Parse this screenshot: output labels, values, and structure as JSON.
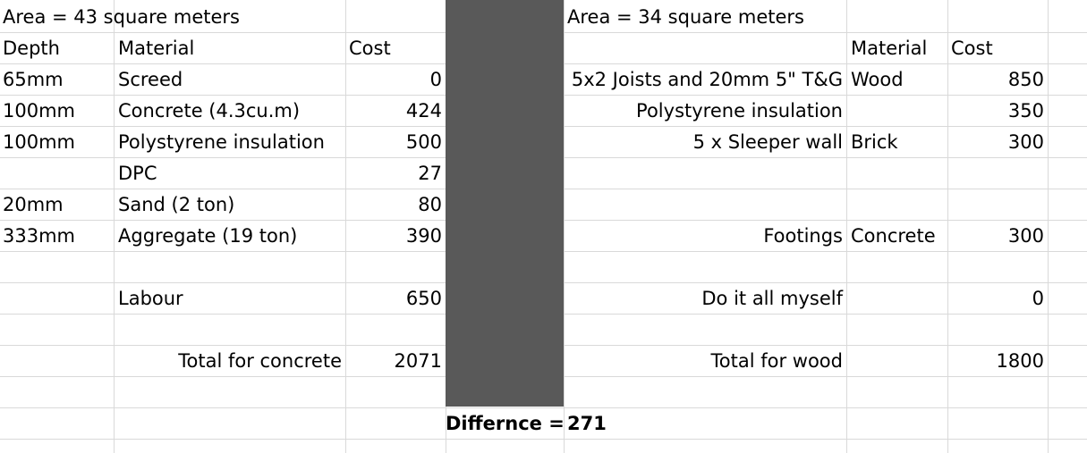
{
  "left_table": {
    "area": "Area = 43 square meters",
    "headers": {
      "depth": "Depth",
      "material": "Material",
      "cost": "Cost"
    },
    "rows": [
      {
        "depth": "65mm",
        "material": "Screed",
        "cost": "0"
      },
      {
        "depth": "100mm",
        "material": "Concrete (4.3cu.m)",
        "cost": "424"
      },
      {
        "depth": "100mm",
        "material": "Polystyrene insulation",
        "cost": "500"
      },
      {
        "depth": "",
        "material": "DPC",
        "cost": "27"
      },
      {
        "depth": "20mm",
        "material": "Sand (2 ton)",
        "cost": "80"
      },
      {
        "depth": "333mm",
        "material": "Aggregate (19 ton)",
        "cost": "390"
      }
    ],
    "labour_label": "Labour",
    "labour_cost": "650",
    "total_label": "Total for concrete",
    "total_value": "2071"
  },
  "right_table": {
    "area": "Area = 34 square meters",
    "headers": {
      "material": "Material",
      "cost": "Cost"
    },
    "rows": [
      {
        "item": "5x2 Joists and 20mm 5\" T&G",
        "material": "Wood",
        "cost": "850"
      },
      {
        "item": "Polystyrene insulation",
        "material": "",
        "cost": "350"
      },
      {
        "item": "5 x Sleeper wall",
        "material": "Brick",
        "cost": "300"
      },
      {
        "item": "Footings",
        "material": "Concrete",
        "cost": "300"
      }
    ],
    "labour_label": "Do it all myself",
    "labour_cost": "0",
    "total_label": "Total for wood",
    "total_value": "1800"
  },
  "difference": {
    "label": "Differnce =",
    "value": "271"
  },
  "colors": {
    "gridline": "#d9d9d9",
    "divider_fill": "#595959"
  }
}
